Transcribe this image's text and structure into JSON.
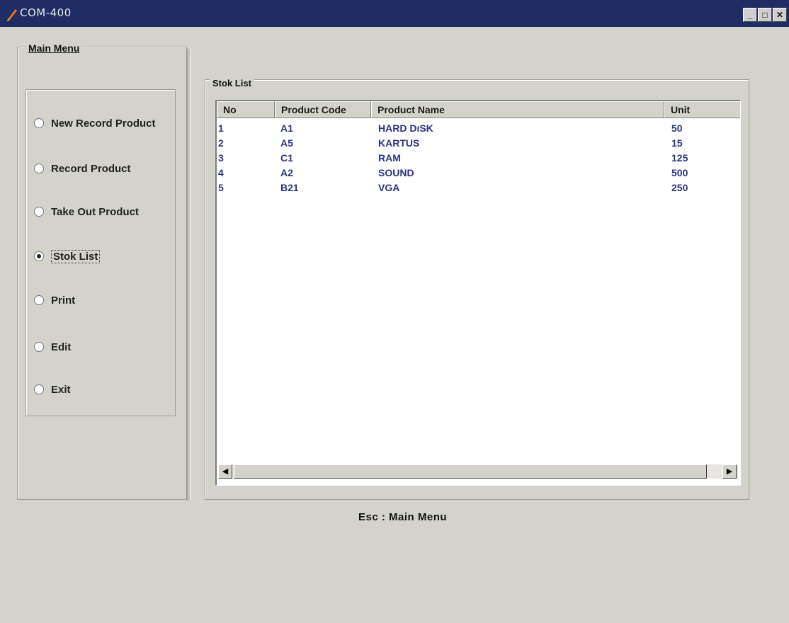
{
  "window": {
    "title": "COM-400",
    "controls": {
      "minimize": "_",
      "maximize": "□",
      "close": "✕"
    },
    "icon": "pencil-icon"
  },
  "sidebar": {
    "title": "Main Menu",
    "items": [
      {
        "label": "New Record Product",
        "selected": false
      },
      {
        "label": "Record Product",
        "selected": false
      },
      {
        "label": "Take Out Product",
        "selected": false
      },
      {
        "label": "Stok List",
        "selected": true
      },
      {
        "label": "Print",
        "selected": false
      },
      {
        "label": "Edit",
        "selected": false
      },
      {
        "label": "Exit",
        "selected": false
      }
    ]
  },
  "stok_list": {
    "group_title": "Stok List",
    "columns": [
      "No",
      "Product Code",
      "Product Name",
      "Unit"
    ],
    "rows": [
      {
        "no": "1",
        "code": "A1",
        "name": "HARD DıSK",
        "unit": "50"
      },
      {
        "no": "2",
        "code": "A5",
        "name": "KARTUS",
        "unit": "15"
      },
      {
        "no": "3",
        "code": "C1",
        "name": "RAM",
        "unit": "125"
      },
      {
        "no": "4",
        "code": "A2",
        "name": "SOUND",
        "unit": "500"
      },
      {
        "no": "5",
        "code": "B21",
        "name": "VGA",
        "unit": "250"
      }
    ],
    "scrollbar": {
      "left_arrow": "◀",
      "right_arrow": "▶"
    }
  },
  "footer": {
    "hint": "Esc : Main Menu"
  },
  "colors": {
    "titlebar": "#1e2d63",
    "window_bg": "#d4d3cb",
    "row_text": "#2b3380"
  }
}
